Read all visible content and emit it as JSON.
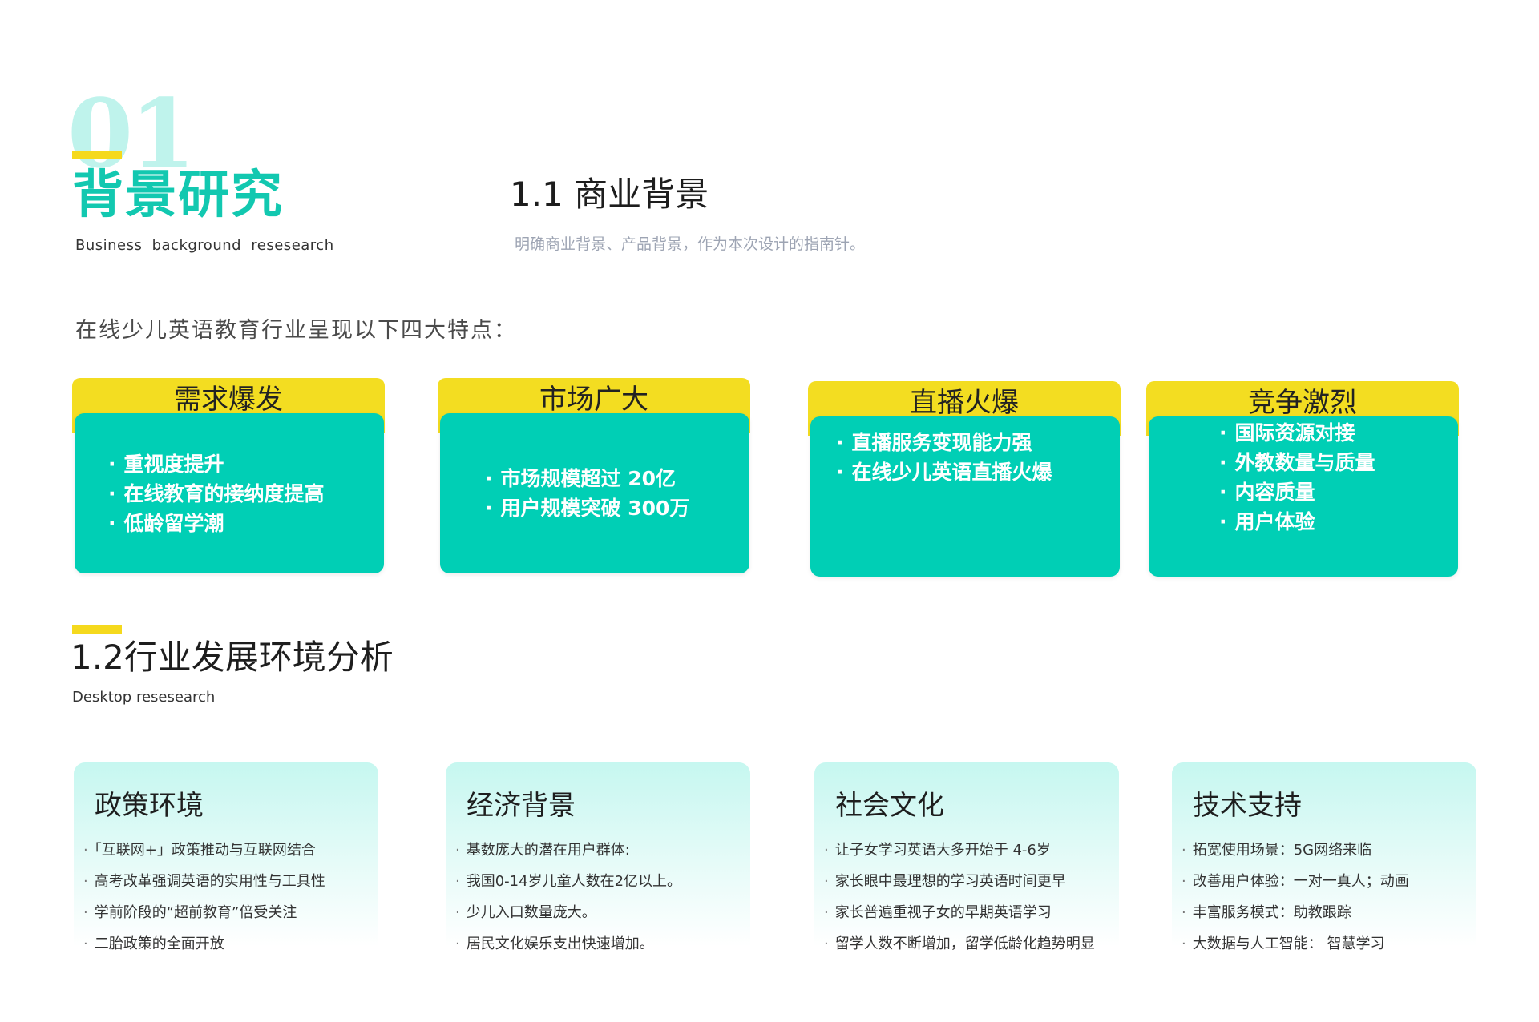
{
  "section": {
    "number": "01",
    "title": "背景研究",
    "subtitle": "Business  background  resesearch"
  },
  "business": {
    "heading": "1.1 商业背景",
    "subheading": "明确商业背景、产品背景，作为本次设计的指南针。",
    "intro": "在线少儿英语教育行业呈现以下四大特点："
  },
  "feature_cards": [
    {
      "title": "需求爆发",
      "items": [
        "重视度提升",
        "在线教育的接纳度提高",
        "低龄留学潮"
      ]
    },
    {
      "title": "市场广大",
      "items": [
        "市场规模超过 20亿",
        "用户规模突破 300万"
      ]
    },
    {
      "title": "直播火爆",
      "items": [
        "直播服务变现能力强",
        "在线少儿英语直播火爆"
      ]
    },
    {
      "title": "竞争激烈",
      "items": [
        "国际资源对接",
        "外教数量与质量",
        "内容质量",
        "用户体验"
      ]
    }
  ],
  "industry": {
    "heading": "1.2行业发展环境分析",
    "subheading": "Desktop resesearch"
  },
  "panels": [
    {
      "title": "政策环境",
      "items": [
        "「互联网+」政策推动与互联网结合",
        "高考改革强调英语的实用性与工具性",
        "学前阶段的“超前教育”倍受关注",
        "二胎政策的全面开放"
      ]
    },
    {
      "title": "经济背景",
      "items": [
        "基数庞大的潜在用户群体:",
        "我国0-14岁儿童人数在2亿以上。",
        "少儿入口数量庞大。",
        "居民文化娱乐支出快速增加。"
      ]
    },
    {
      "title": "社会文化",
      "items": [
        "让子女学习英语大多开始于 4-6岁",
        "家长眼中最理想的学习英语时间更早",
        "家长普遍重视子女的早期英语学习",
        "留学人数不断增加，留学低龄化趋势明显"
      ]
    },
    {
      "title": "技术支持",
      "items": [
        "拓宽使用场景：5G网络来临",
        "改善用户体验：一对一真人；动画",
        "丰富服务模式：助教跟踪",
        "大数据与人工智能：  智慧学习"
      ]
    }
  ],
  "colors": {
    "teal": "#00cfb5",
    "yellow": "#f3dd21",
    "title_teal": "#12c8b0"
  }
}
